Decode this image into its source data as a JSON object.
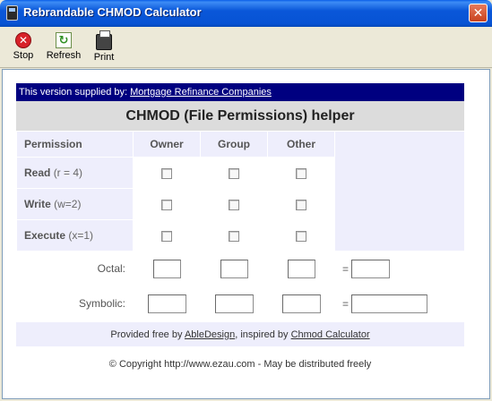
{
  "window": {
    "title": "Rebrandable CHMOD Calculator",
    "close_glyph": "✕"
  },
  "toolbar": {
    "stop_label": "Stop",
    "refresh_label": "Refresh",
    "print_label": "Print"
  },
  "supplier": {
    "prefix": "This version supplied by:",
    "link": "Mortgage Refinance Companies"
  },
  "helper_title": "CHMOD (File Permissions) helper",
  "table": {
    "headers": [
      "Permission",
      "Owner",
      "Group",
      "Other"
    ],
    "rows": [
      {
        "name": "Read",
        "note": "(r = 4)"
      },
      {
        "name": "Write",
        "note": "(w=2)"
      },
      {
        "name": "Execute",
        "note": "(x=1)"
      }
    ],
    "octal_label": "Octal:",
    "symbolic_label": "Symbolic:",
    "equals": "="
  },
  "credits": {
    "prefix": "Provided free by",
    "link1": "AbleDesign",
    "middle": ", inspired by",
    "link2": "Chmod Calculator"
  },
  "copyright": "© Copyright http://www.ezau.com - May be distributed freely",
  "colors": {
    "titlebar": "#0753d4",
    "supplier_bg": "#000080",
    "table_bg": "#eeeefc",
    "header_bg": "#dcdcdc"
  }
}
